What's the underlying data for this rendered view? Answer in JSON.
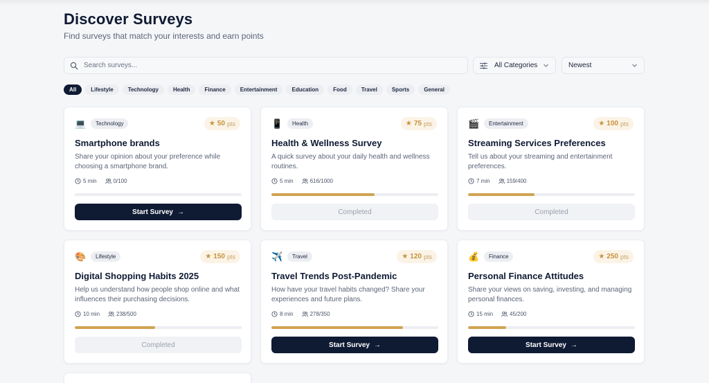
{
  "header": {
    "title": "Discover Surveys",
    "subtitle": "Find surveys that match your interests and earn points"
  },
  "search": {
    "placeholder": "Search surveys...",
    "value": ""
  },
  "filters": {
    "category": "All Categories",
    "sort": "Newest"
  },
  "chips": [
    "All",
    "Lifestyle",
    "Technology",
    "Health",
    "Finance",
    "Entertainment",
    "Education",
    "Food",
    "Travel",
    "Sports",
    "General"
  ],
  "chips_active": "All",
  "colors": {
    "primary": "#0f1a33",
    "accent": "#d1a352",
    "points_bg": "#fbf3e6"
  },
  "labels": {
    "start": "Start Survey",
    "completed": "Completed",
    "pts_unit": "pts"
  },
  "cards": [
    {
      "icon": "laptop-icon",
      "glyph": "💻",
      "category": "Technology",
      "points": "50",
      "title": "Smartphone brands",
      "description": "Share your opinion about your preference while choosing a smartphone brand.",
      "duration": "5 min",
      "participants": "0/100",
      "progress": 0.0,
      "status": "start"
    },
    {
      "icon": "mobile-health-icon",
      "glyph": "📱",
      "category": "Health",
      "points": "75",
      "title": "Health & Wellness Survey",
      "description": "A quick survey about your daily health and wellness routines.",
      "duration": "5 min",
      "participants": "616/1000",
      "progress": 0.62,
      "status": "completed"
    },
    {
      "icon": "clapperboard-icon",
      "glyph": "🎬",
      "category": "Entertainment",
      "points": "100",
      "title": "Streaming Services Preferences",
      "description": "Tell us about your streaming and entertainment preferences.",
      "duration": "7 min",
      "participants": "159/400",
      "progress": 0.4,
      "status": "completed"
    },
    {
      "icon": "palette-icon",
      "glyph": "🎨",
      "category": "Lifestyle",
      "points": "150",
      "title": "Digital Shopping Habits 2025",
      "description": "Help us understand how people shop online and what influences their purchasing decisions.",
      "duration": "10 min",
      "participants": "238/500",
      "progress": 0.48,
      "status": "completed"
    },
    {
      "icon": "airplane-icon",
      "glyph": "✈️",
      "category": "Travel",
      "points": "120",
      "title": "Travel Trends Post-Pandemic",
      "description": "How have your travel habits changed? Share your experiences and future plans.",
      "duration": "8 min",
      "participants": "278/350",
      "progress": 0.79,
      "status": "start"
    },
    {
      "icon": "money-bag-icon",
      "glyph": "💰",
      "category": "Finance",
      "points": "250",
      "title": "Personal Finance Attitudes",
      "description": "Share your views on saving, investing, and managing personal finances.",
      "duration": "15 min",
      "participants": "45/200",
      "progress": 0.23,
      "status": "start"
    }
  ]
}
